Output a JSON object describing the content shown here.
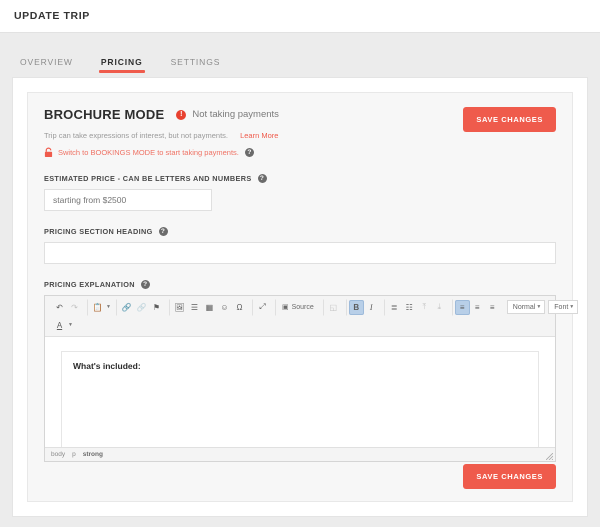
{
  "header": {
    "title": "UPDATE TRIP"
  },
  "tabs": [
    {
      "label": "OVERVIEW",
      "active": false
    },
    {
      "label": "PRICING",
      "active": true
    },
    {
      "label": "SETTINGS",
      "active": false
    }
  ],
  "brochure": {
    "title": "BROCHURE MODE",
    "status_badge_glyph": "!",
    "status_text": "Not taking payments",
    "description": "Trip can take expressions of interest, but not payments.",
    "learn_more": "Learn More",
    "switch_text": "Switch to BOOKINGS MODE to start taking payments.",
    "help_glyph": "?"
  },
  "fields": {
    "estimated_price": {
      "label": "ESTIMATED PRICE - CAN BE LETTERS AND NUMBERS",
      "placeholder": "starting from $2500",
      "value": ""
    },
    "pricing_heading": {
      "label": "PRICING SECTION HEADING",
      "placeholder": "",
      "value": ""
    },
    "pricing_explanation": {
      "label": "PRICING EXPLANATION"
    }
  },
  "editor": {
    "toolbar_row1": [
      {
        "name": "undo-icon",
        "glyph": "↶",
        "state": "normal"
      },
      {
        "name": "redo-icon",
        "glyph": "↷",
        "state": "disabled"
      },
      {
        "name": "paste-icon",
        "glyph": "📋",
        "state": "normal",
        "caret": true
      },
      {
        "name": "link-icon",
        "glyph": "🔗",
        "state": "normal"
      },
      {
        "name": "unlink-icon",
        "glyph": "🔗",
        "state": "disabled"
      },
      {
        "name": "anchor-flag-icon",
        "glyph": "⚑",
        "state": "normal"
      },
      {
        "name": "image-icon",
        "glyph": "🖼",
        "state": "normal"
      },
      {
        "name": "page-break-icon",
        "glyph": "☰",
        "state": "normal"
      },
      {
        "name": "table-icon",
        "glyph": "▦",
        "state": "normal"
      },
      {
        "name": "smiley-icon",
        "glyph": "☺",
        "state": "normal"
      },
      {
        "name": "special-char-icon",
        "glyph": "Ω",
        "state": "normal"
      },
      {
        "name": "maximize-icon",
        "glyph": "⤢",
        "state": "normal"
      },
      {
        "name": "source-button",
        "glyph": "▣",
        "state": "normal",
        "label": "Source"
      },
      {
        "name": "templates-icon",
        "glyph": "◱",
        "state": "disabled"
      },
      {
        "name": "bold-button",
        "glyph": "B",
        "state": "active"
      },
      {
        "name": "italic-button",
        "glyph": "I",
        "state": "normal"
      },
      {
        "name": "numbered-list-icon",
        "glyph": "≣",
        "state": "normal"
      },
      {
        "name": "bulleted-list-icon",
        "glyph": "☷",
        "state": "normal"
      },
      {
        "name": "outdent-icon",
        "glyph": "⤒",
        "state": "disabled"
      },
      {
        "name": "indent-icon",
        "glyph": "⤓",
        "state": "disabled"
      },
      {
        "name": "align-left-icon",
        "glyph": "≡",
        "state": "active"
      },
      {
        "name": "align-center-icon",
        "glyph": "≡",
        "state": "normal"
      },
      {
        "name": "align-right-icon",
        "glyph": "≡",
        "state": "normal"
      }
    ],
    "format_select": {
      "name": "paragraph-format-select",
      "value": "Normal"
    },
    "font_select": {
      "name": "font-family-select",
      "value": "Font"
    },
    "toolbar_row2": [
      {
        "name": "text-color-icon",
        "glyph": "A",
        "state": "normal",
        "caret": true
      }
    ],
    "content": "What's included:",
    "breadcrumb": [
      {
        "label": "body",
        "bold": false
      },
      {
        "label": "p",
        "bold": false
      },
      {
        "label": "strong",
        "bold": true
      }
    ]
  },
  "buttons": {
    "save_top": "SAVE CHANGES",
    "save_bottom": "SAVE CHANGES"
  },
  "colors": {
    "accent": "#ef5b4c",
    "warning": "#e8412f",
    "page_bg": "#ececec",
    "panel_bg": "#f7f7f7",
    "toolbar_active": "#b8cfe8"
  }
}
